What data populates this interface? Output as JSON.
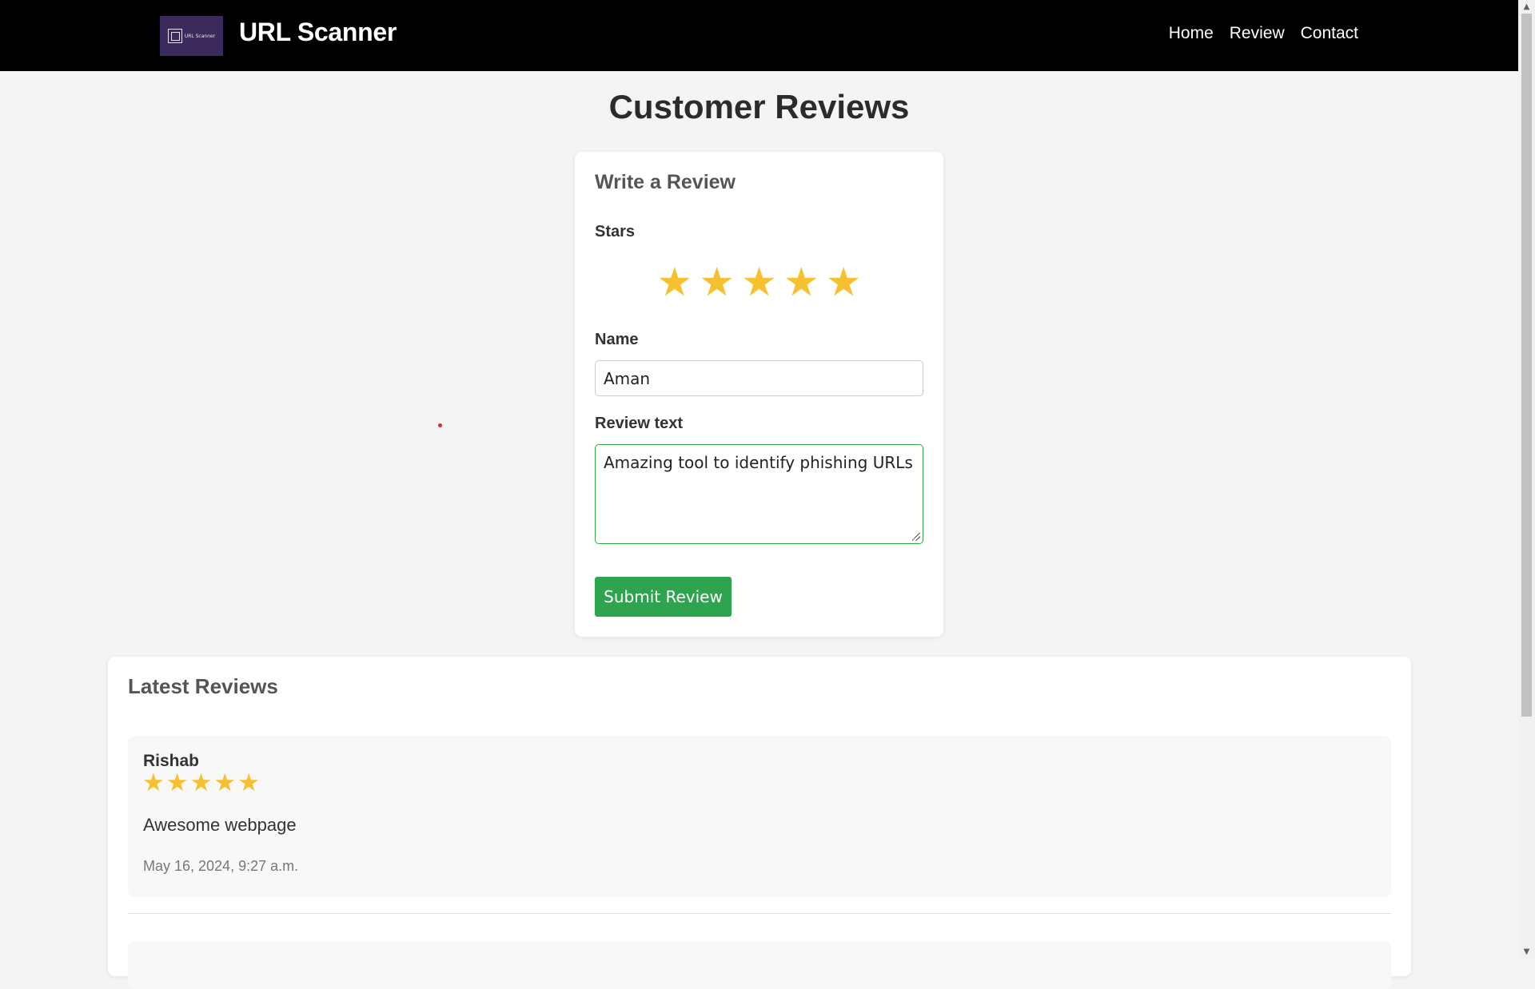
{
  "header": {
    "logo_text": "URL Scanner",
    "brand_title": "URL Scanner",
    "nav": [
      "Home",
      "Review",
      "Contact"
    ]
  },
  "page_title": "Customer Reviews",
  "form": {
    "heading": "Write a Review",
    "stars_label": "Stars",
    "selected_stars": 5,
    "name_label": "Name",
    "name_value": "Aman",
    "review_label": "Review text",
    "review_value": "Amazing tool to identify phishing URLs",
    "submit_label": "Submit Review"
  },
  "latest": {
    "heading": "Latest Reviews",
    "reviews": [
      {
        "author": "Rishab",
        "stars": 5,
        "text": "Awesome webpage",
        "date": "May 16, 2024, 9:27 a.m."
      }
    ]
  },
  "colors": {
    "star": "#f6c02f",
    "submit": "#2ea44f",
    "navbar": "#000000"
  }
}
